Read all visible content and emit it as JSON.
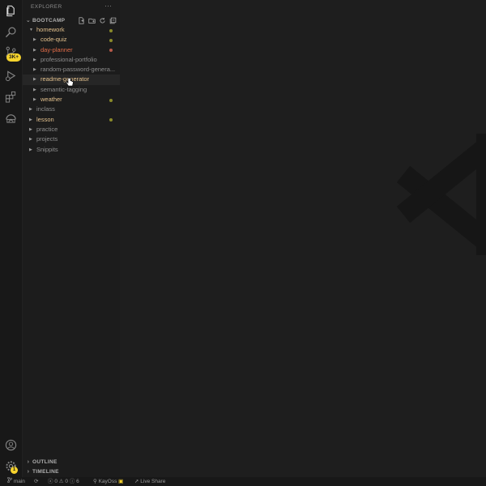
{
  "colors": {
    "modified": "#e2c08d",
    "error": "#e06c48",
    "normal": "#cccccc",
    "muted": "#8c8c8c",
    "dot_modified": "#8a8a2a",
    "dot_error": "#b85a4a"
  },
  "activity_bar": {
    "icons": [
      "files-icon",
      "search-icon",
      "source-control-icon",
      "run-debug-icon",
      "extensions-icon",
      "remote-explorer-icon",
      "account-icon",
      "gear-icon"
    ],
    "source_control_badge": "3K+",
    "gear_badge": "1"
  },
  "sidebar": {
    "title": "EXPLORER",
    "more": "···",
    "workspace": "BOOTCAMP",
    "outline": "OUTLINE",
    "timeline": "TIMELINE"
  },
  "tree": [
    {
      "label": "homework",
      "depth": 0,
      "expanded": true,
      "state": "modified",
      "dot": true
    },
    {
      "label": "code-quiz",
      "depth": 1,
      "expanded": false,
      "state": "modified",
      "dot": true
    },
    {
      "label": "day-planner",
      "depth": 1,
      "expanded": false,
      "state": "error",
      "dot": true
    },
    {
      "label": "professional-portfolio",
      "depth": 1,
      "expanded": false,
      "state": "muted",
      "dot": false
    },
    {
      "label": "random-password-genera...",
      "depth": 1,
      "expanded": false,
      "state": "muted",
      "dot": false
    },
    {
      "label": "readme-generator",
      "depth": 1,
      "expanded": false,
      "state": "modified",
      "dot": false,
      "hover": true
    },
    {
      "label": "semantic-tagging",
      "depth": 1,
      "expanded": false,
      "state": "muted",
      "dot": false
    },
    {
      "label": "weather",
      "depth": 1,
      "expanded": false,
      "state": "modified",
      "dot": true
    },
    {
      "label": "inclass",
      "depth": 0,
      "expanded": false,
      "state": "muted",
      "dot": false
    },
    {
      "label": "lesson",
      "depth": 0,
      "expanded": false,
      "state": "modified",
      "dot": true
    },
    {
      "label": "practice",
      "depth": 0,
      "expanded": false,
      "state": "muted",
      "dot": false
    },
    {
      "label": "projects",
      "depth": 0,
      "expanded": false,
      "state": "muted",
      "dot": false
    },
    {
      "label": "Snippits",
      "depth": 0,
      "expanded": false,
      "state": "muted",
      "dot": false
    }
  ],
  "status_bar": {
    "branch": "main",
    "errors": "0",
    "warnings": "0",
    "info": "6",
    "user": "KayOss",
    "live_share": "Live Share"
  }
}
